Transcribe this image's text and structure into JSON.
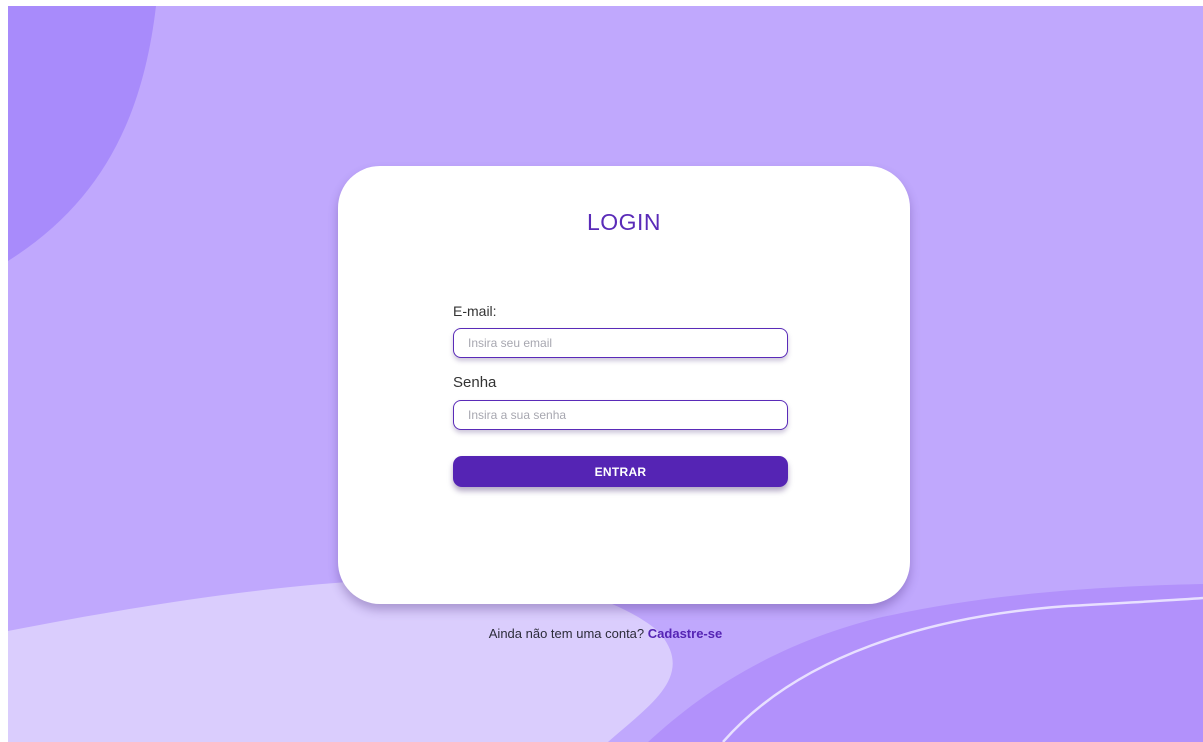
{
  "login": {
    "title": "LOGIN",
    "email_label": "E-mail:",
    "email_placeholder": "Insira seu email",
    "email_value": "",
    "password_label": "Senha",
    "password_placeholder": "Insira a sua senha",
    "password_value": "",
    "submit_label": "ENTRAR"
  },
  "signup": {
    "prompt": "Ainda não tem uma conta?",
    "link_label": "Cadastre-se"
  },
  "colors": {
    "background": "#c0a8fd",
    "accent": "#5524b4",
    "card": "#ffffff",
    "blob_dark": "#a78bfa",
    "blob_light": "#dacdfd"
  }
}
